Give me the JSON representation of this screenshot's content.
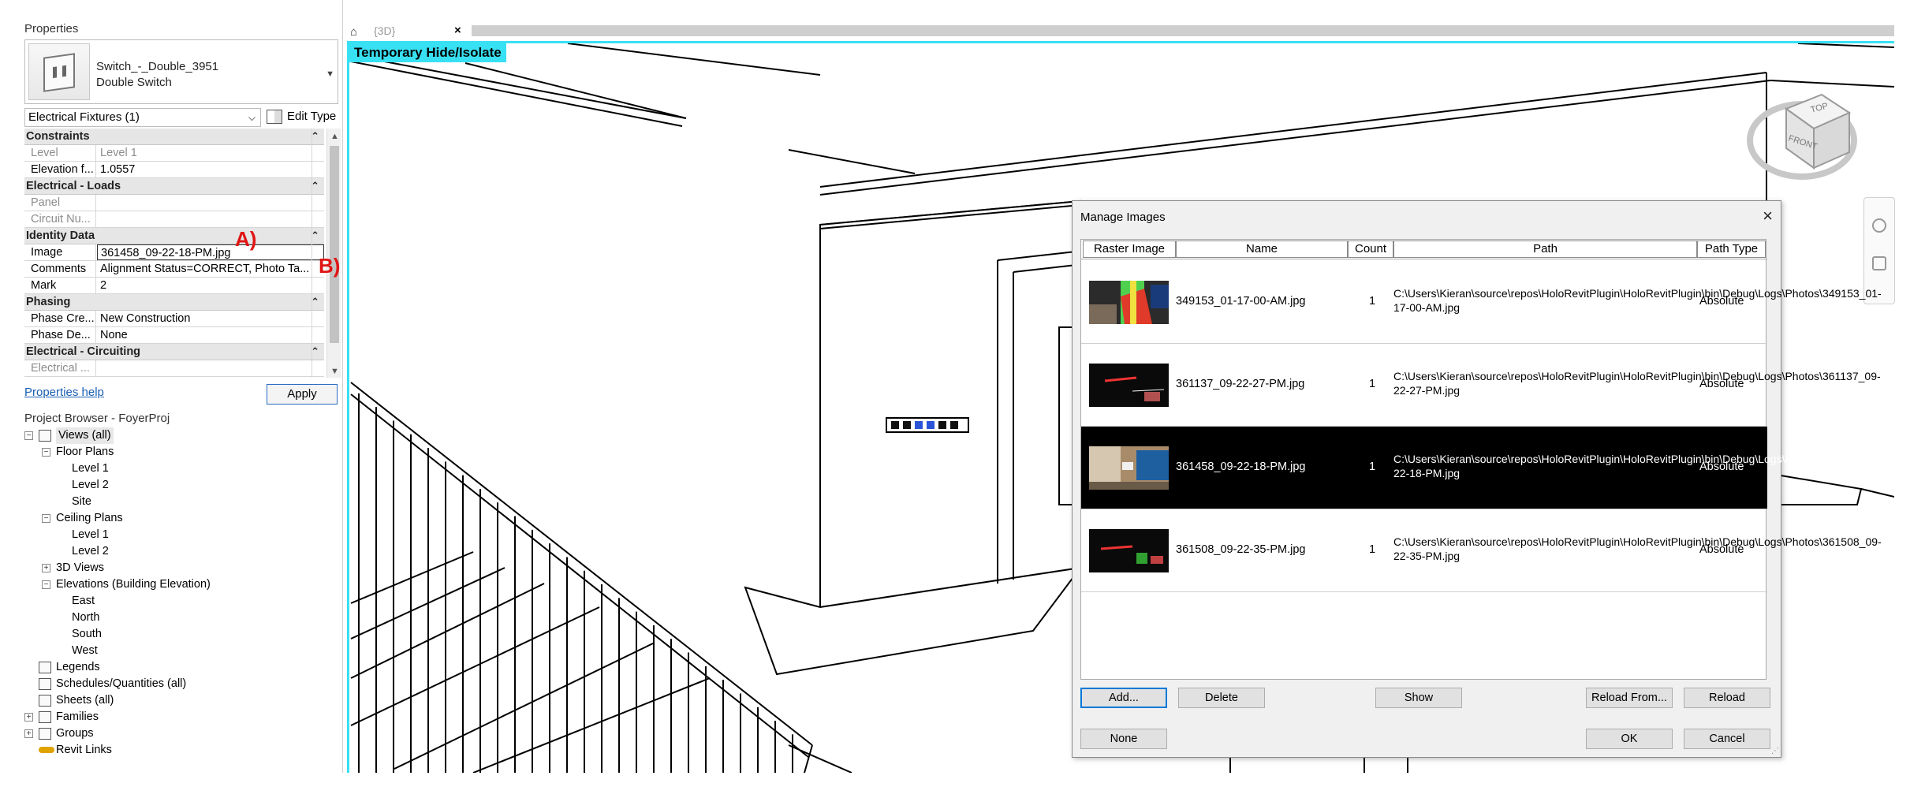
{
  "properties": {
    "title": "Properties",
    "type_name": "Switch_-_Double_3951",
    "type_subname": "Double Switch",
    "filter": "Electrical Fixtures (1)",
    "edit_type": "Edit Type",
    "groups": [
      {
        "name": "Constraints",
        "rows": [
          {
            "label": "Level",
            "value": "Level 1",
            "dim": true
          },
          {
            "label": "Elevation f...",
            "value": "1.0557",
            "dim": false
          }
        ]
      },
      {
        "name": "Electrical - Loads",
        "rows": [
          {
            "label": "Panel",
            "value": "",
            "dim": true
          },
          {
            "label": "Circuit Nu...",
            "value": "",
            "dim": true
          }
        ]
      },
      {
        "name": "Identity Data",
        "rows": [
          {
            "label": "Image",
            "value": "361458_09-22-18-PM.jpg",
            "dim": false
          },
          {
            "label": "Comments",
            "value": "Alignment Status=CORRECT, Photo Ta...",
            "dim": false
          },
          {
            "label": "Mark",
            "value": "2",
            "dim": false
          }
        ]
      },
      {
        "name": "Phasing",
        "rows": [
          {
            "label": "Phase Cre...",
            "value": "New Construction",
            "dim": false
          },
          {
            "label": "Phase De...",
            "value": "None",
            "dim": false
          }
        ]
      },
      {
        "name": "Electrical - Circuiting",
        "rows": [
          {
            "label": "Electrical ...",
            "value": "",
            "dim": true
          }
        ]
      }
    ],
    "annotation_a": "A)",
    "annotation_b": "B)",
    "help_link": "Properties help",
    "apply": "Apply"
  },
  "project_browser": {
    "title": "Project Browser - FoyerProj",
    "nodes": [
      {
        "label": "Views (all)",
        "level": 0,
        "toggle": "-",
        "icon": "views-icon"
      },
      {
        "label": "Floor Plans",
        "level": 1,
        "toggle": "-"
      },
      {
        "label": "Level 1",
        "level": 2
      },
      {
        "label": "Level 2",
        "level": 2
      },
      {
        "label": "Site",
        "level": 2
      },
      {
        "label": "Ceiling Plans",
        "level": 1,
        "toggle": "-"
      },
      {
        "label": "Level 1",
        "level": 2
      },
      {
        "label": "Level 2",
        "level": 2
      },
      {
        "label": "3D Views",
        "level": 1,
        "toggle": "+"
      },
      {
        "label": "Elevations (Building Elevation)",
        "level": 1,
        "toggle": "-"
      },
      {
        "label": "East",
        "level": 2
      },
      {
        "label": "North",
        "level": 2
      },
      {
        "label": "South",
        "level": 2
      },
      {
        "label": "West",
        "level": 2
      },
      {
        "label": "Legends",
        "level": 0,
        "icon": "legends-icon"
      },
      {
        "label": "Schedules/Quantities (all)",
        "level": 0,
        "icon": "schedules-icon"
      },
      {
        "label": "Sheets (all)",
        "level": 0,
        "icon": "sheets-icon"
      },
      {
        "label": "Families",
        "level": 0,
        "toggle": "+",
        "icon": "families-icon"
      },
      {
        "label": "Groups",
        "level": 0,
        "toggle": "+",
        "icon": "groups-icon"
      },
      {
        "label": "Revit Links",
        "level": 0,
        "icon": "revit-links-icon"
      }
    ]
  },
  "viewport": {
    "tab_label": "{3D}",
    "tab_close": "×",
    "banner": "Temporary Hide/Isolate",
    "cube_top": "TOP",
    "cube_front": "FRONT",
    "accent": "#38e0f3"
  },
  "dialog": {
    "title": "Manage Images",
    "close": "×",
    "columns": [
      "Raster Image",
      "Name",
      "Count",
      "Path",
      "Path Type"
    ],
    "rows": [
      {
        "name": "349153_01-17-00-AM.jpg",
        "count": "1",
        "path": "C:\\Users\\Kieran\\source\\repos\\HoloRevitPlugin\\HoloRevitPlugin\\bin\\Debug\\Logs\\Photos\\349153_01-17-00-AM.jpg",
        "type": "Absolute",
        "selected": false
      },
      {
        "name": "361137_09-22-27-PM.jpg",
        "count": "1",
        "path": "C:\\Users\\Kieran\\source\\repos\\HoloRevitPlugin\\HoloRevitPlugin\\bin\\Debug\\Logs\\Photos\\361137_09-22-27-PM.jpg",
        "type": "Absolute",
        "selected": false
      },
      {
        "name": "361458_09-22-18-PM.jpg",
        "count": "1",
        "path": "C:\\Users\\Kieran\\source\\repos\\HoloRevitPlugin\\HoloRevitPlugin\\bin\\Debug\\Logs\\Photos\\361458_09-22-18-PM.jpg",
        "type": "Absolute",
        "selected": true
      },
      {
        "name": "361508_09-22-35-PM.jpg",
        "count": "1",
        "path": "C:\\Users\\Kieran\\source\\repos\\HoloRevitPlugin\\HoloRevitPlugin\\bin\\Debug\\Logs\\Photos\\361508_09-22-35-PM.jpg",
        "type": "Absolute",
        "selected": false
      }
    ],
    "buttons": {
      "add": "Add...",
      "delete": "Delete",
      "show": "Show",
      "reload_from": "Reload From...",
      "reload": "Reload",
      "none": "None",
      "ok": "OK",
      "cancel": "Cancel"
    }
  }
}
